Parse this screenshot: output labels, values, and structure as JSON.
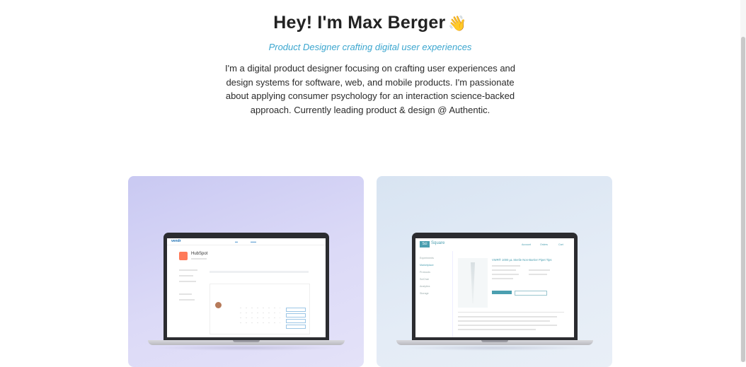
{
  "hero": {
    "title": "Hey! I'm Max Berger",
    "emoji": "👋",
    "subtitle": "Product Designer crafting digital user experiences",
    "intro": "I'm a digital product designer focusing on crafting user experiences and design systems for software, web, and mobile products. I'm passionate about applying consumer psychology for an interaction science-backed approach. Currently leading product & design @ Authentic."
  },
  "cards": [
    {
      "name": "vendr-project",
      "background": "#d9d7f6",
      "screen": {
        "logo": "vendr",
        "company": "HubSpot"
      }
    },
    {
      "name": "sciquare-project",
      "background": "#e3ebf5",
      "screen": {
        "logo_badge": "Sci",
        "logo_text": "Square",
        "nav": [
          "Experiments",
          "Marketplace",
          "Protocols",
          "SciChat",
          "Analytics",
          "Storage"
        ],
        "top_nav": [
          "Account",
          "Orders",
          "Cart"
        ],
        "product_title": "VWR® 1000 μL Sterile Non-Barrier Pipet Tips"
      }
    }
  ],
  "colors": {
    "accent": "#3ba6cf",
    "text": "#222222"
  }
}
